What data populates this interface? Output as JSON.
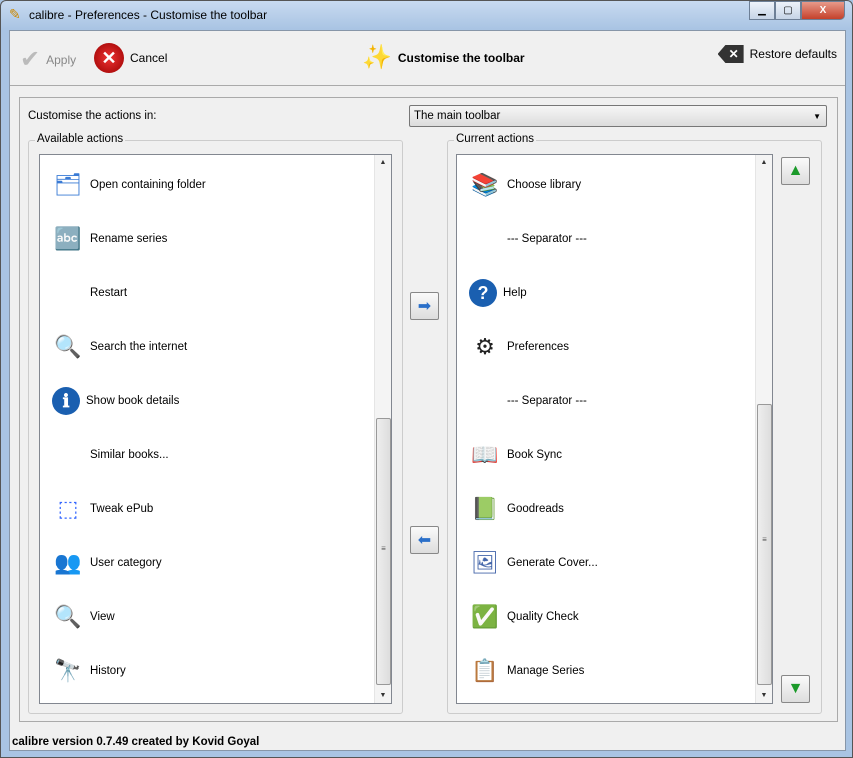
{
  "window": {
    "title": "calibre - Preferences - Customise the toolbar",
    "minimize": "▁",
    "maximize": "▢",
    "close": "X"
  },
  "toolbar": {
    "apply": "Apply",
    "cancel": "Cancel",
    "heading": "Customise the toolbar",
    "restore": "Restore defaults"
  },
  "main": {
    "customise_label": "Customise the actions in:",
    "combo_value": "The main toolbar",
    "available_title": "Available actions",
    "current_title": "Current actions",
    "available": [
      {
        "label": "Open containing folder",
        "icon": "folder-icon"
      },
      {
        "label": "Rename series",
        "icon": "rename-icon"
      },
      {
        "label": "Restart",
        "icon": ""
      },
      {
        "label": "Search the internet",
        "icon": "search-globe-icon"
      },
      {
        "label": "Show book details",
        "icon": "info-icon"
      },
      {
        "label": "Similar books...",
        "icon": ""
      },
      {
        "label": "Tweak ePub",
        "icon": "tweak-icon"
      },
      {
        "label": "User category",
        "icon": "user-category-icon"
      },
      {
        "label": "View",
        "icon": "magnifier-icon"
      },
      {
        "label": "History",
        "icon": "binoculars-icon"
      }
    ],
    "current": [
      {
        "label": "Choose library",
        "icon": "library-icon"
      },
      {
        "label": "--- Separator ---",
        "icon": ""
      },
      {
        "label": "Help",
        "icon": "help-icon"
      },
      {
        "label": "Preferences",
        "icon": "gears-icon"
      },
      {
        "label": "--- Separator ---",
        "icon": ""
      },
      {
        "label": "Book Sync",
        "icon": "book-sync-icon"
      },
      {
        "label": "Goodreads",
        "icon": "goodreads-icon"
      },
      {
        "label": "Generate Cover...",
        "icon": "generate-cover-icon"
      },
      {
        "label": "Quality Check",
        "icon": "quality-check-icon"
      },
      {
        "label": "Manage Series",
        "icon": "manage-series-icon"
      }
    ]
  },
  "status": "calibre version 0.7.49 created by Kovid Goyal"
}
